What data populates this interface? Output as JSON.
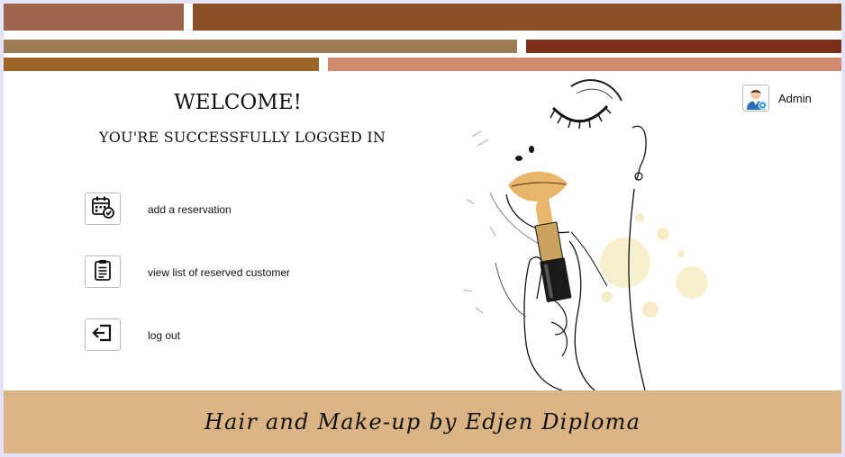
{
  "header": {
    "bar_colors": [
      "#9c644a",
      "#8a4f25",
      "#9d7b55",
      "#7c2e1a",
      "#9c6426",
      "#d18c6f"
    ]
  },
  "main": {
    "welcome": "WELCOME!",
    "subtitle": "YOU'RE SUCCESSFULLY LOGGED IN"
  },
  "menu": {
    "items": [
      {
        "label": "add a reservation",
        "icon": "calendar-check-icon"
      },
      {
        "label": "view list of reserved customer",
        "icon": "clipboard-list-icon"
      },
      {
        "label": "log out",
        "icon": "logout-icon"
      }
    ]
  },
  "user": {
    "name": "Admin",
    "icon": "user-avatar-icon"
  },
  "footer": {
    "text": "Hair and Make-up by Edjen Diploma",
    "background": "#dab485"
  }
}
